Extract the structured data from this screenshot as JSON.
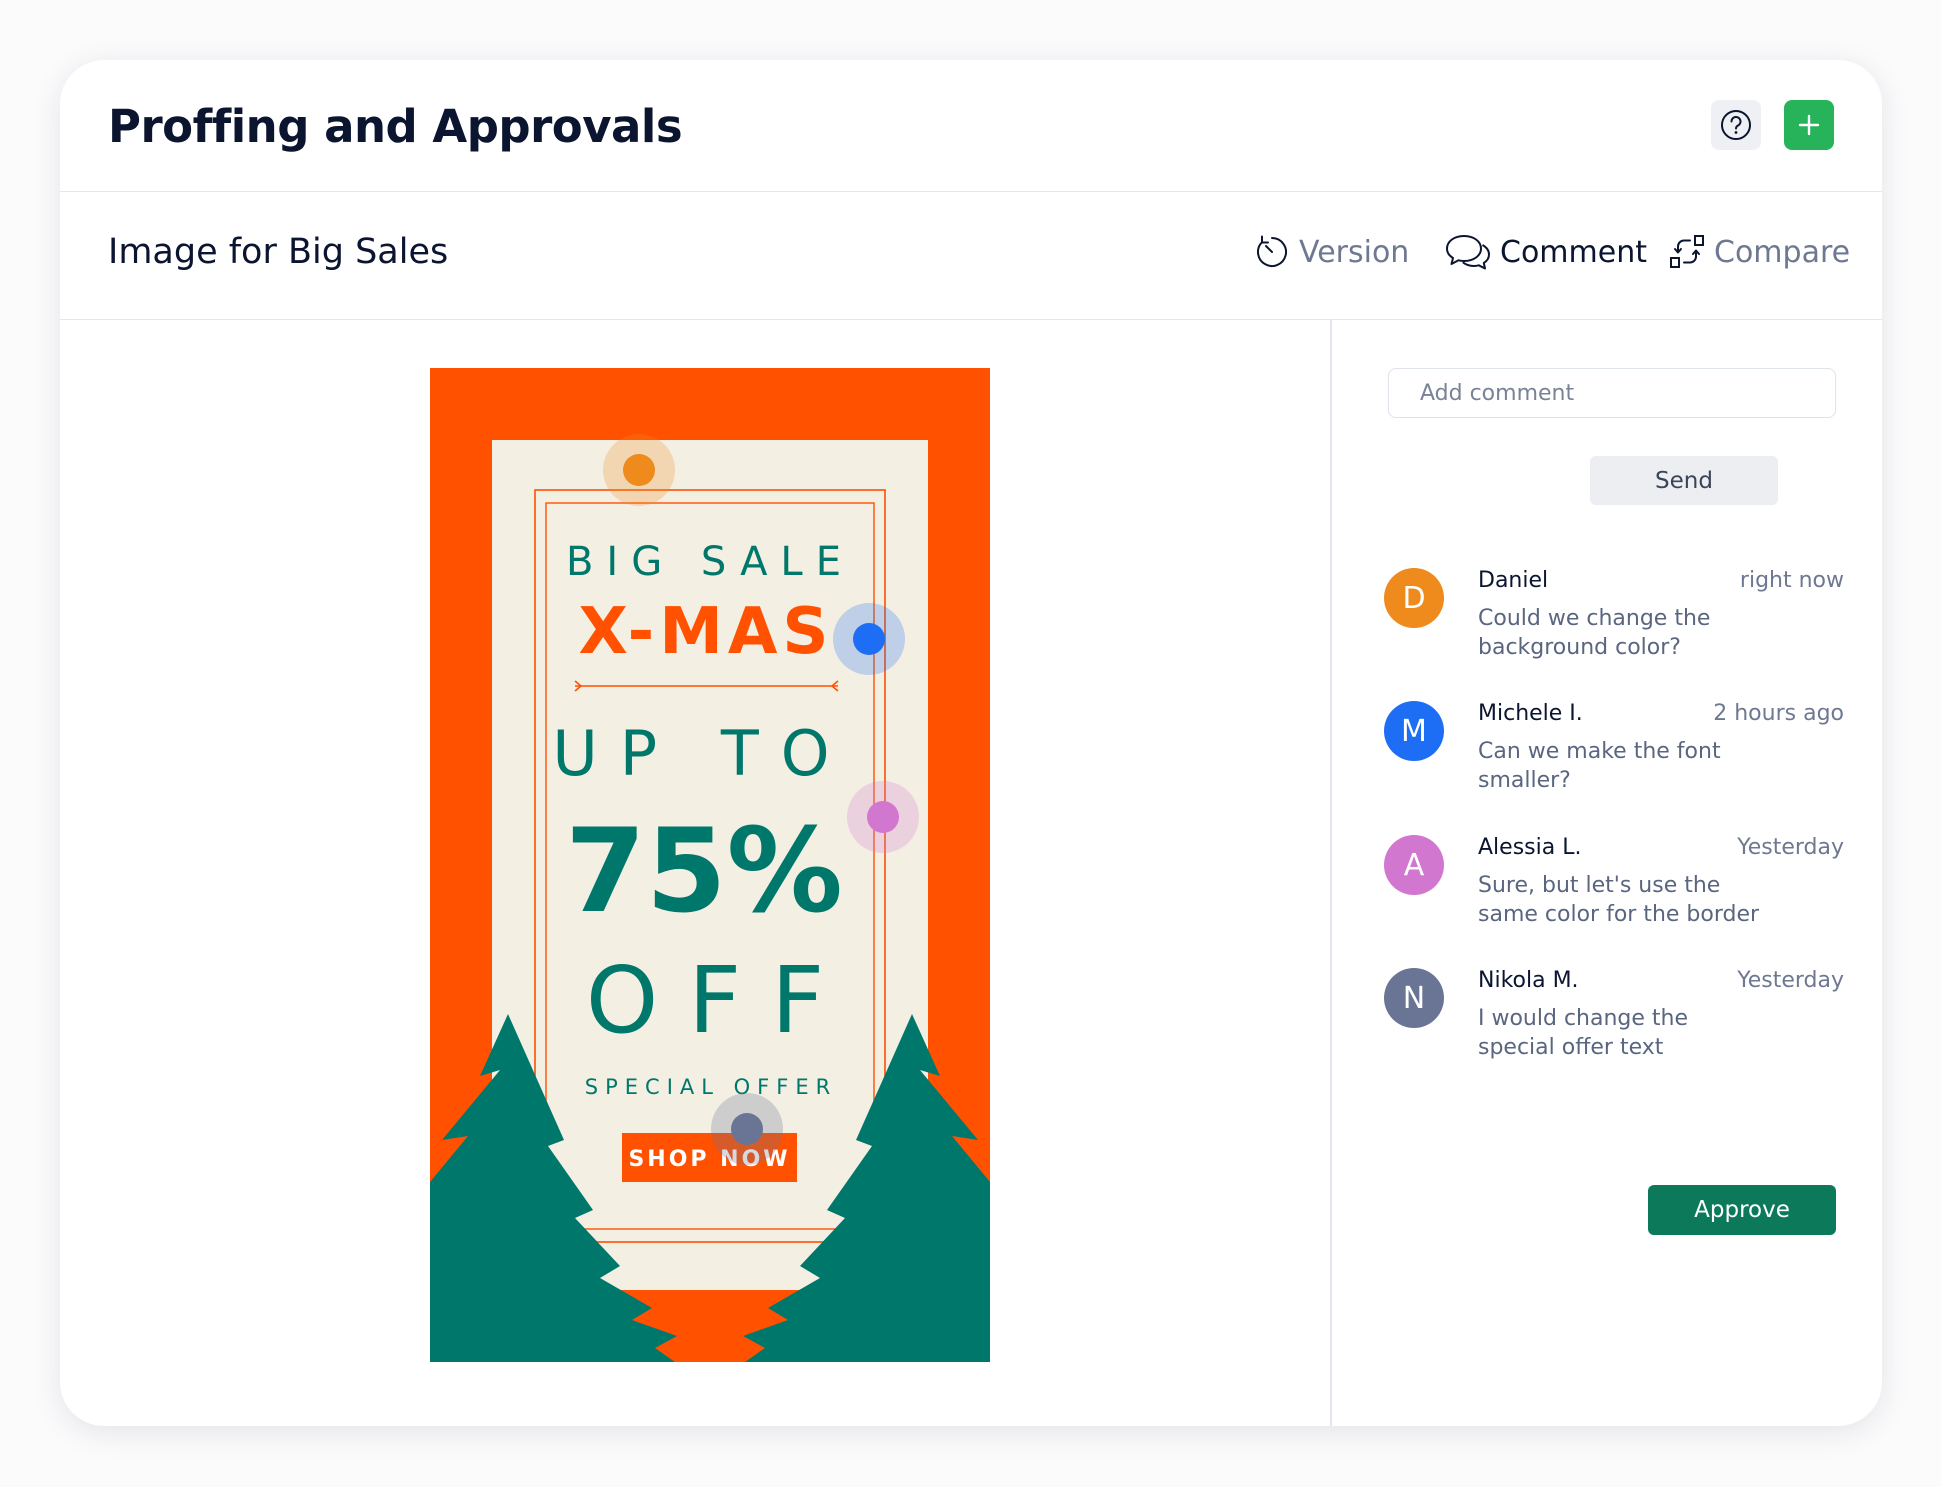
{
  "header": {
    "title": "Proffing and Approvals",
    "help_icon": "question-circle-icon",
    "add_icon": "plus-icon"
  },
  "document": {
    "title": "Image for Big Sales"
  },
  "toolbar": {
    "version_label": "Version",
    "comment_label": "Comment",
    "compare_label": "Compare",
    "active_tab": "Comment"
  },
  "poster": {
    "line1": "BIG SALE",
    "line2": "X-MAS",
    "line3": "UP TO",
    "line4": "75%",
    "line5": "OFF",
    "line6": "SPECIAL OFFER",
    "cta": "SHOP NOW",
    "colors": {
      "orange": "#ff5100",
      "cream": "#f3efe3",
      "teal": "#00776b"
    }
  },
  "pins": [
    {
      "author": "Daniel",
      "color": "#ef8a1c"
    },
    {
      "author": "Michele I.",
      "color": "#1e6ef5"
    },
    {
      "author": "Alessia L.",
      "color": "#d277cf"
    },
    {
      "author": "Nikola M.",
      "color": "#6a7596"
    }
  ],
  "comment_box": {
    "placeholder": "Add comment",
    "send_label": "Send"
  },
  "comments": [
    {
      "initial": "D",
      "name": "Daniel",
      "time": "right now",
      "text": "Could we change the background color?",
      "color": "#ef8a1c"
    },
    {
      "initial": "M",
      "name": "Michele I.",
      "time": "2 hours ago",
      "text": "Can we make the font smaller?",
      "color": "#1e6ef5"
    },
    {
      "initial": "A",
      "name": "Alessia L.",
      "time": "Yesterday",
      "text": "Sure, but let's use the same color for the border",
      "color": "#d277cf"
    },
    {
      "initial": "N",
      "name": "Nikola M.",
      "time": "Yesterday",
      "text": "I would change the special offer text",
      "color": "#6a7596"
    }
  ],
  "approve_label": "Approve"
}
